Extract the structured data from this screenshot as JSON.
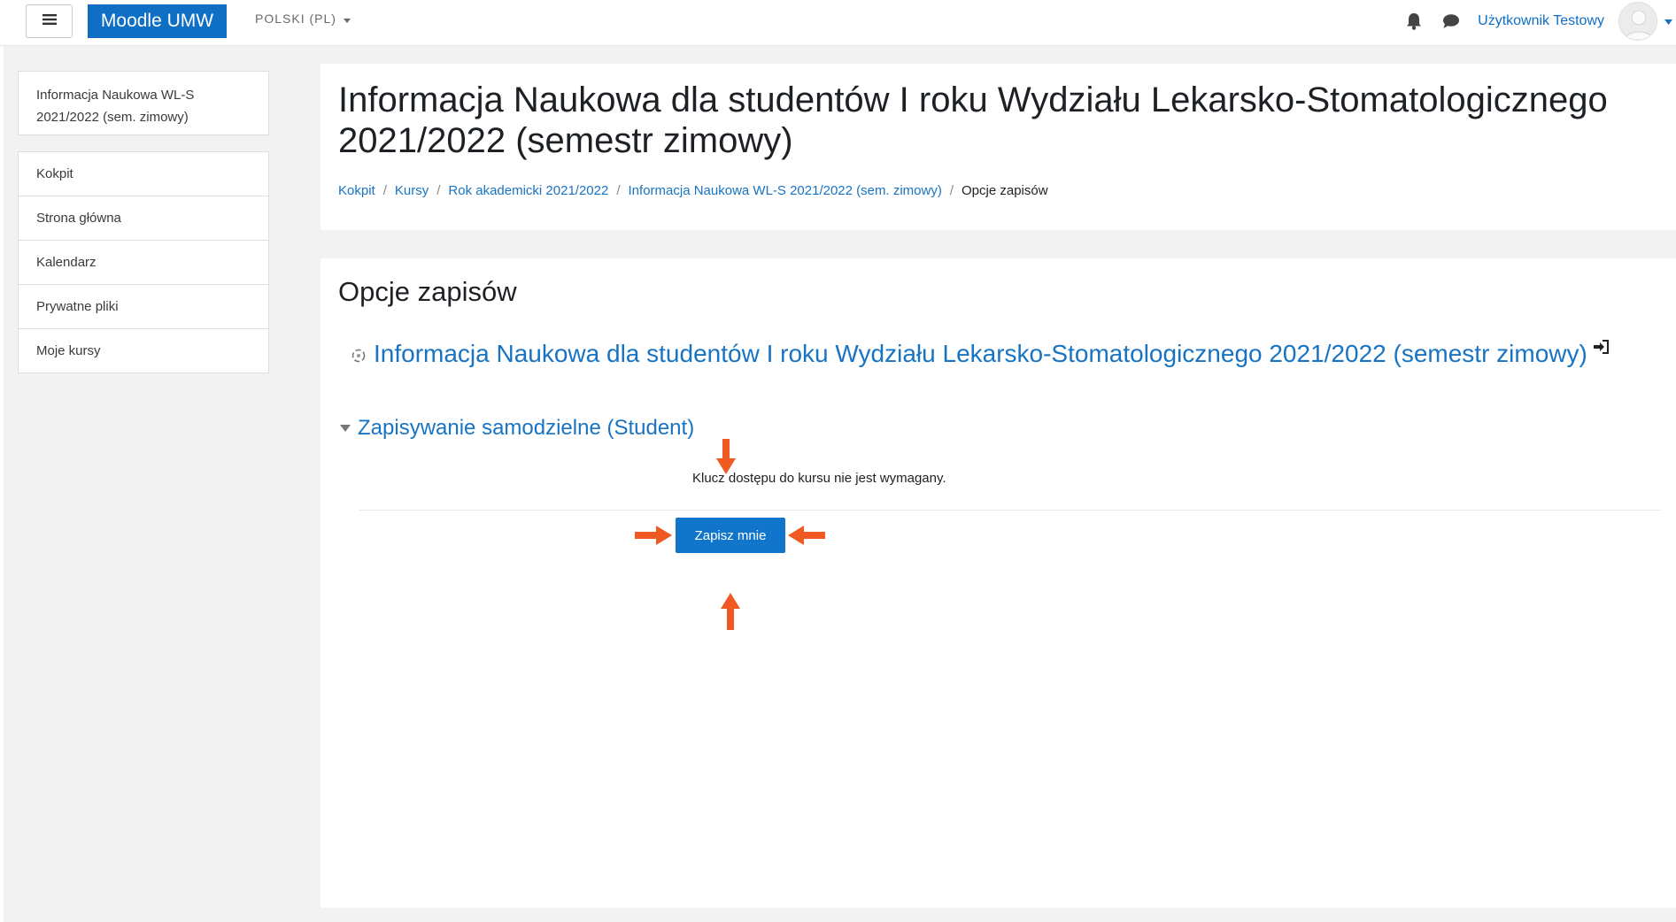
{
  "navbar": {
    "brand": "Moodle UMW",
    "language": "POLSKI (PL)",
    "user_name": "Użytkownik Testowy",
    "icons": [
      "menu-icon",
      "bell-icon",
      "chat-icon",
      "avatar-icon",
      "caret-down-icon"
    ]
  },
  "drawer": {
    "course_name": "Informacja Naukowa WL-S 2021/2022 (sem. zimowy)",
    "items": [
      {
        "label": "Kokpit"
      },
      {
        "label": "Strona główna"
      },
      {
        "label": "Kalendarz"
      },
      {
        "label": "Prywatne pliki"
      },
      {
        "label": "Moje kursy"
      }
    ]
  },
  "header": {
    "title": "Informacja Naukowa dla studentów I roku Wydziału Lekarsko-Stomatologicznego 2021/2022 (semestr zimowy)",
    "breadcrumb": [
      {
        "label": "Kokpit"
      },
      {
        "label": "Kursy"
      },
      {
        "label": "Rok akademicki 2021/2022"
      },
      {
        "label": "Informacja Naukowa WL-S 2021/2022 (sem. zimowy)"
      },
      {
        "label": "Opcje zapisów"
      }
    ]
  },
  "main": {
    "section_title": "Opcje zapisów",
    "course_link": "Informacja Naukowa dla studentów I roku Wydziału Lekarsko-Stomatologicznego 2021/2022 (semestr zimowy)",
    "enrol_method_title": "Zapisywanie samodzielne (Student)",
    "key_note": "Klucz dostępu do kursu nie jest wymagany.",
    "enrol_button": "Zapisz mnie"
  },
  "colors": {
    "brand": "#0f6fc5",
    "link": "#1874c3",
    "button": "#1175cb",
    "annotation_arrow": "#f05a22",
    "page_background": "#f2f2f2"
  }
}
